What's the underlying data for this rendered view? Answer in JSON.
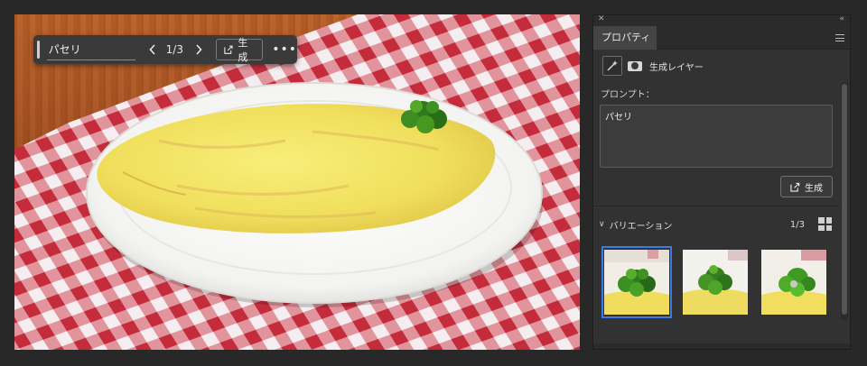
{
  "taskbar": {
    "prompt_value": "パセリ",
    "prev_icon": "chevron-left-icon",
    "count": "1/3",
    "next_icon": "chevron-right-icon",
    "generate_label": "生成",
    "more_icon": "ellipsis-icon"
  },
  "panel": {
    "tab_label": "プロパティ",
    "layer_type": "生成レイヤー",
    "prompt_label": "プロンプト：",
    "prompt_value": "パセリ",
    "generate_label": "生成",
    "variations_label": "バリエーション",
    "variations_count": "1/3",
    "selected_variation_index": 0
  },
  "colors": {
    "selection": "#3b7be8",
    "panel_bg": "#323232",
    "taskbar_bg": "#3a3a3a"
  }
}
